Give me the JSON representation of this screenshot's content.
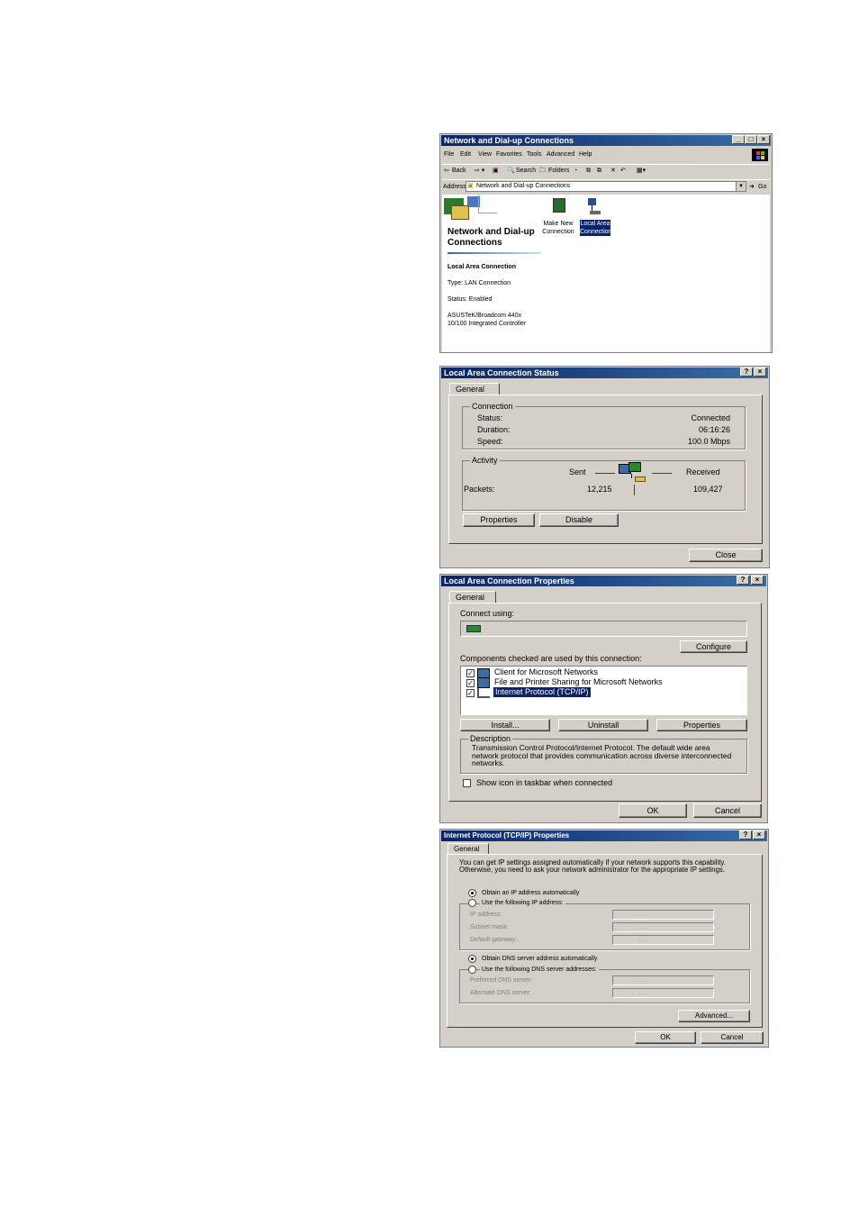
{
  "w1": {
    "title": "Network and Dial-up Connections",
    "menu": [
      "File",
      "Edit",
      "View",
      "Favorites",
      "Tools",
      "Advanced",
      "Help"
    ],
    "toolbar": {
      "back": "Back",
      "search": "Search",
      "folders": "Folders"
    },
    "address_label": "Address",
    "address_value": "Network and Dial-up Connections",
    "go_label": "Go",
    "heading": "Network and Dial-up Connections",
    "details": {
      "name": "Local Area Connection",
      "type": "Type: LAN Connection",
      "status": "Status: Enabled",
      "adapter": "ASUSTeK/Broadcom 440x 10/100 Integrated Controller"
    },
    "icons": [
      {
        "label": "Make New Connection"
      },
      {
        "label": "Local Area Connection"
      }
    ]
  },
  "w2": {
    "title": "Local Area Connection Status",
    "tab": "General",
    "connection_group": "Connection",
    "status_label": "Status:",
    "status_value": "Connected",
    "duration_label": "Duration:",
    "duration_value": "06:16:26",
    "speed_label": "Speed:",
    "speed_value": "100.0 Mbps",
    "activity_group": "Activity",
    "sent_label": "Sent",
    "received_label": "Received",
    "packets_label": "Packets:",
    "packets_sent": "12,215",
    "packets_received": "109,427",
    "properties_btn": "Properties",
    "disable_btn": "Disable",
    "close_btn": "Close"
  },
  "w3": {
    "title": "Local Area Connection Properties",
    "tab": "General",
    "connect_using": "Connect using:",
    "configure_btn": "Configure",
    "components_label": "Components checked are used by this connection:",
    "components": [
      "Client for Microsoft Networks",
      "File and Printer Sharing for Microsoft Networks",
      "Internet Protocol (TCP/IP)"
    ],
    "install_btn": "Install...",
    "uninstall_btn": "Uninstall",
    "properties_btn": "Properties",
    "description_group": "Description",
    "description": "Transmission Control Protocol/Internet Protocol. The default wide area network protocol that provides communication across diverse interconnected networks.",
    "show_icon": "Show icon in taskbar when connected",
    "ok_btn": "OK",
    "cancel_btn": "Cancel"
  },
  "w4": {
    "title": "Internet Protocol (TCP/IP) Properties",
    "tab": "General",
    "intro": "You can get IP settings assigned automatically if your network supports this capability. Otherwise, you need to ask your network administrator for the appropriate IP settings.",
    "obtain_ip": "Obtain an IP address automatically",
    "use_ip": "Use the following IP address:",
    "ip_address": "IP address:",
    "subnet_mask": "Subnet mask:",
    "default_gateway": "Default gateway:",
    "obtain_dns": "Obtain DNS server address automatically",
    "use_dns": "Use the following DNS server addresses:",
    "preferred_dns": "Preferred DNS server:",
    "alternate_dns": "Alternate DNS server:",
    "ip_placeholder": ".   .   .",
    "advanced_btn": "Advanced...",
    "ok_btn": "OK",
    "cancel_btn": "Cancel"
  },
  "colors": {
    "title_start": "#0a246a",
    "title_end": "#3a6ea5",
    "face": "#d4d0c8",
    "selection": "#0a246a"
  }
}
